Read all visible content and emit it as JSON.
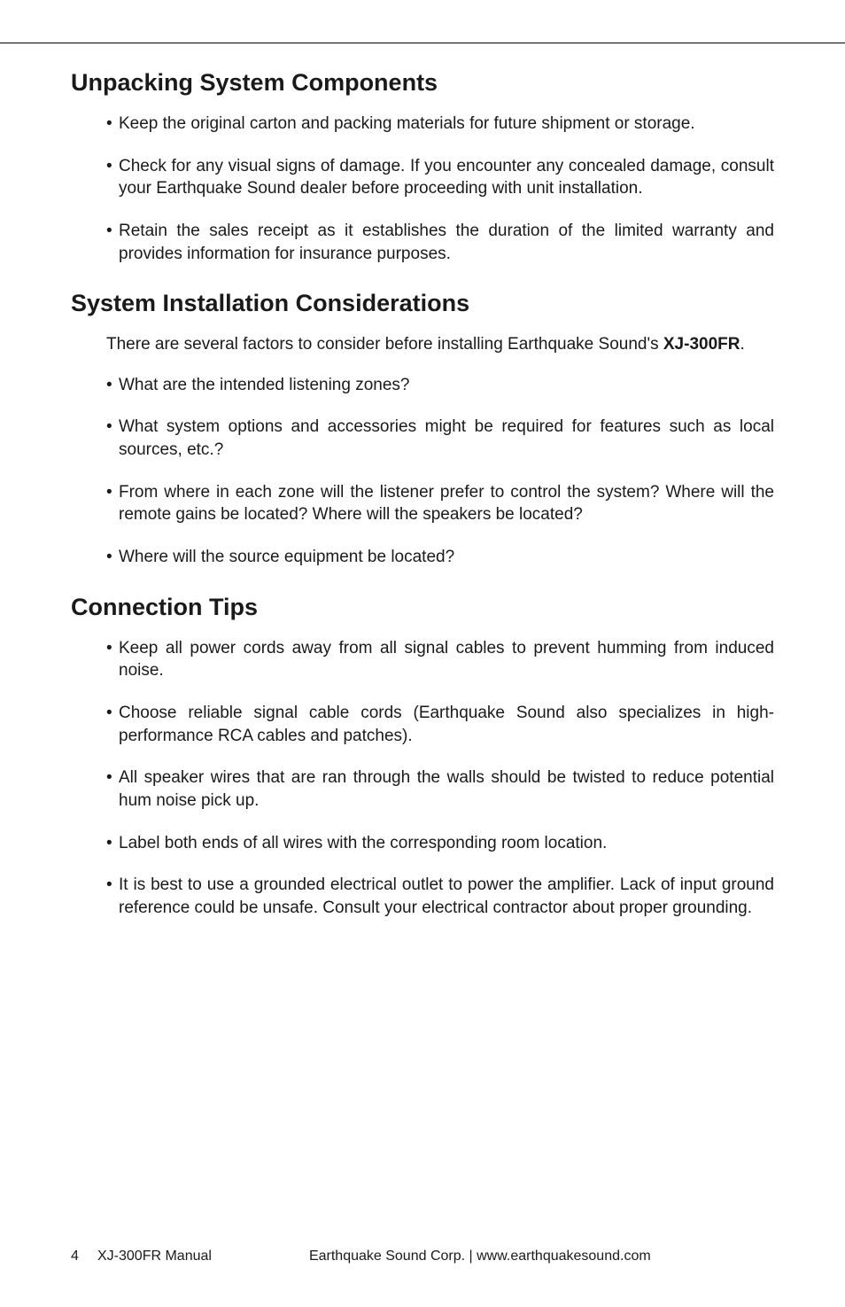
{
  "headings": {
    "h1": "Unpacking System Components",
    "h2": "System Installation Considerations",
    "h3": "Connection Tips"
  },
  "section1": {
    "items": [
      "Keep the original carton and packing materials for future shipment or storage.",
      "Check for any visual signs of damage. If you encounter any concealed damage, consult your Earthquake Sound dealer before proceeding with unit installation.",
      "Retain the sales receipt as it establishes the duration of the limited warranty and provides information for insurance purposes."
    ]
  },
  "section2": {
    "lead_prefix": "There are several factors to consider before installing Earthquake Sound's ",
    "lead_bold": "XJ-300FR",
    "lead_suffix": ".",
    "items": [
      "What are the intended listening zones?",
      "What system options and accessories might be required for features such as local sources, etc.?",
      "From where in each zone will the listener prefer to control the system? Where will the remote gains be located? Where will the speakers be located?",
      "Where will the source equipment be located?"
    ]
  },
  "section3": {
    "items": [
      "Keep all power cords away from all signal cables to prevent humming from induced noise.",
      "Choose reliable signal cable cords (Earthquake Sound also specializes in high-performance RCA cables and patches).",
      "All speaker wires that are ran through the walls should be twisted to reduce potential hum noise pick up.",
      "Label both ends of all wires with the corresponding room location.",
      "It is best to use a grounded electrical outlet to power the amplifier. Lack of input ground reference could be unsafe. Consult your electrical contractor about proper grounding."
    ]
  },
  "footer": {
    "page": "4",
    "title": "XJ-300FR Manual",
    "corp": "Earthquake Sound Corp.  |  www.earthquakesound.com"
  }
}
